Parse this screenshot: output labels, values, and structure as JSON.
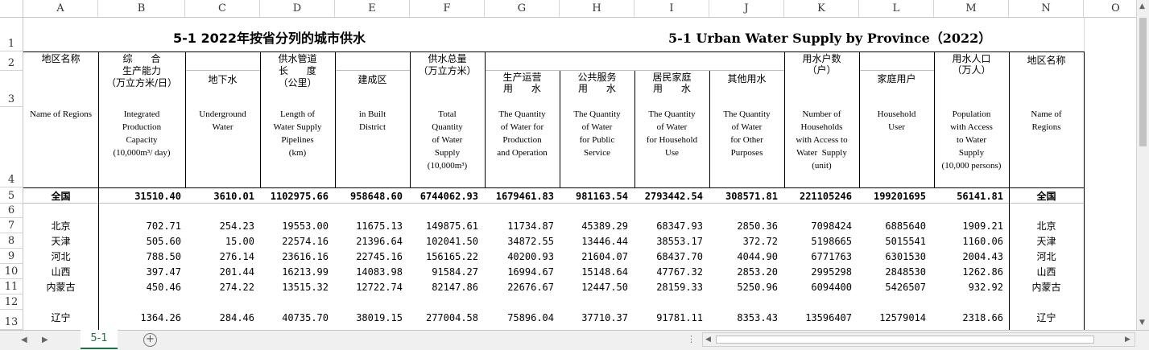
{
  "columns": [
    "A",
    "B",
    "C",
    "D",
    "E",
    "F",
    "G",
    "H",
    "I",
    "J",
    "K",
    "L",
    "M",
    "N",
    "O"
  ],
  "row_numbers": [
    "1",
    "2",
    "3",
    "4",
    "5",
    "6",
    "7",
    "8",
    "9",
    "10",
    "11",
    "12",
    "13"
  ],
  "title_cn": "5-1    2022年按省分列的城市供水",
  "title_en": "5-1 Urban Water Supply by Province（2022）",
  "headers": {
    "region_cn": "地区名称",
    "region_en": "Name of Regions",
    "capacity_cn": "综      合\n生产能力\n（万立方米/日）",
    "capacity_en": "Integrated\nProduction\nCapacity\n(10,000m³/ day)",
    "underground_cn": "地下水",
    "underground_en": "Underground\nWater",
    "pipe_cn": "供水管道\n长      度\n（公里）",
    "pipe_en": "Length of\nWater Supply\nPipelines\n(km)",
    "built_cn": "建成区",
    "built_en": "in Built\nDistrict",
    "total_cn": "供水总量\n（万立方米）",
    "total_en": "Total\nQuantity\nof Water\nSupply\n(10,000m³)",
    "production_cn": "生产运营\n用      水",
    "production_en": "The Quantity\nof Water for\nProduction\nand Operation",
    "public_cn": "公共服务\n用      水",
    "public_en": "The Quantity\nof Water\nfor Public\nService",
    "household_cn": "居民家庭\n用      水",
    "household_en": "The Quantity\nof Water\nfor Household\nUse",
    "other_cn": "其他用水",
    "other_en": "The Quantity\nof Water\nfor Other\nPurposes",
    "households_cn": "用水户数\n（户）",
    "households_en": "Number of\nHouseholds\nwith Access to\nWater  Supply\n(unit)",
    "household_user_cn": "家庭用户",
    "household_user_en": "Household\nUser",
    "population_cn": "用水人口\n（万人）",
    "population_en": "Population\nwith Access\nto Water\nSupply\n(10,000 persons)",
    "region2_cn": "地区名称",
    "region2_en": "Name of\nRegions"
  },
  "rows": [
    {
      "rownum": "5",
      "name": "全国",
      "v": [
        "31510.40",
        "3610.01",
        "1102975.66",
        "958648.60",
        "6744062.93",
        "1679461.83",
        "981163.54",
        "2793442.54",
        "308571.81",
        "221105246",
        "199201695",
        "56141.81"
      ],
      "name2": "全国",
      "bold": true
    },
    {
      "rownum": "7",
      "name": "北京",
      "v": [
        "702.71",
        "254.23",
        "19553.00",
        "11675.13",
        "149875.61",
        "11734.87",
        "45389.29",
        "68347.93",
        "2850.36",
        "7098424",
        "6885640",
        "1909.21"
      ],
      "name2": "北京"
    },
    {
      "rownum": "8",
      "name": "天津",
      "v": [
        "505.60",
        "15.00",
        "22574.16",
        "21396.64",
        "102041.50",
        "34872.55",
        "13446.44",
        "38553.17",
        "372.72",
        "5198665",
        "5015541",
        "1160.06"
      ],
      "name2": "天津"
    },
    {
      "rownum": "9",
      "name": "河北",
      "v": [
        "788.50",
        "276.14",
        "23616.16",
        "22745.16",
        "156165.22",
        "40200.93",
        "21604.07",
        "68437.70",
        "4044.90",
        "6771763",
        "6301530",
        "2004.43"
      ],
      "name2": "河北"
    },
    {
      "rownum": "10",
      "name": "山西",
      "v": [
        "397.47",
        "201.44",
        "16213.99",
        "14083.98",
        "91584.27",
        "16994.67",
        "15148.64",
        "47767.32",
        "2853.20",
        "2995298",
        "2848530",
        "1262.86"
      ],
      "name2": "山西"
    },
    {
      "rownum": "11",
      "name": "内蒙古",
      "v": [
        "450.46",
        "274.22",
        "13515.32",
        "12722.74",
        "82147.86",
        "22676.67",
        "12447.50",
        "28159.33",
        "5250.96",
        "6094400",
        "5426507",
        "932.92"
      ],
      "name2": "内蒙古"
    },
    {
      "rownum": "13",
      "name": "辽宁",
      "v": [
        "1364.26",
        "284.46",
        "40735.70",
        "38019.15",
        "277004.58",
        "75896.04",
        "37710.37",
        "91781.11",
        "8353.43",
        "13596407",
        "12579014",
        "2318.66"
      ],
      "name2": "辽宁"
    }
  ],
  "sheet_tab": "5-1",
  "add_sheet_icon": "plus-circle-icon"
}
